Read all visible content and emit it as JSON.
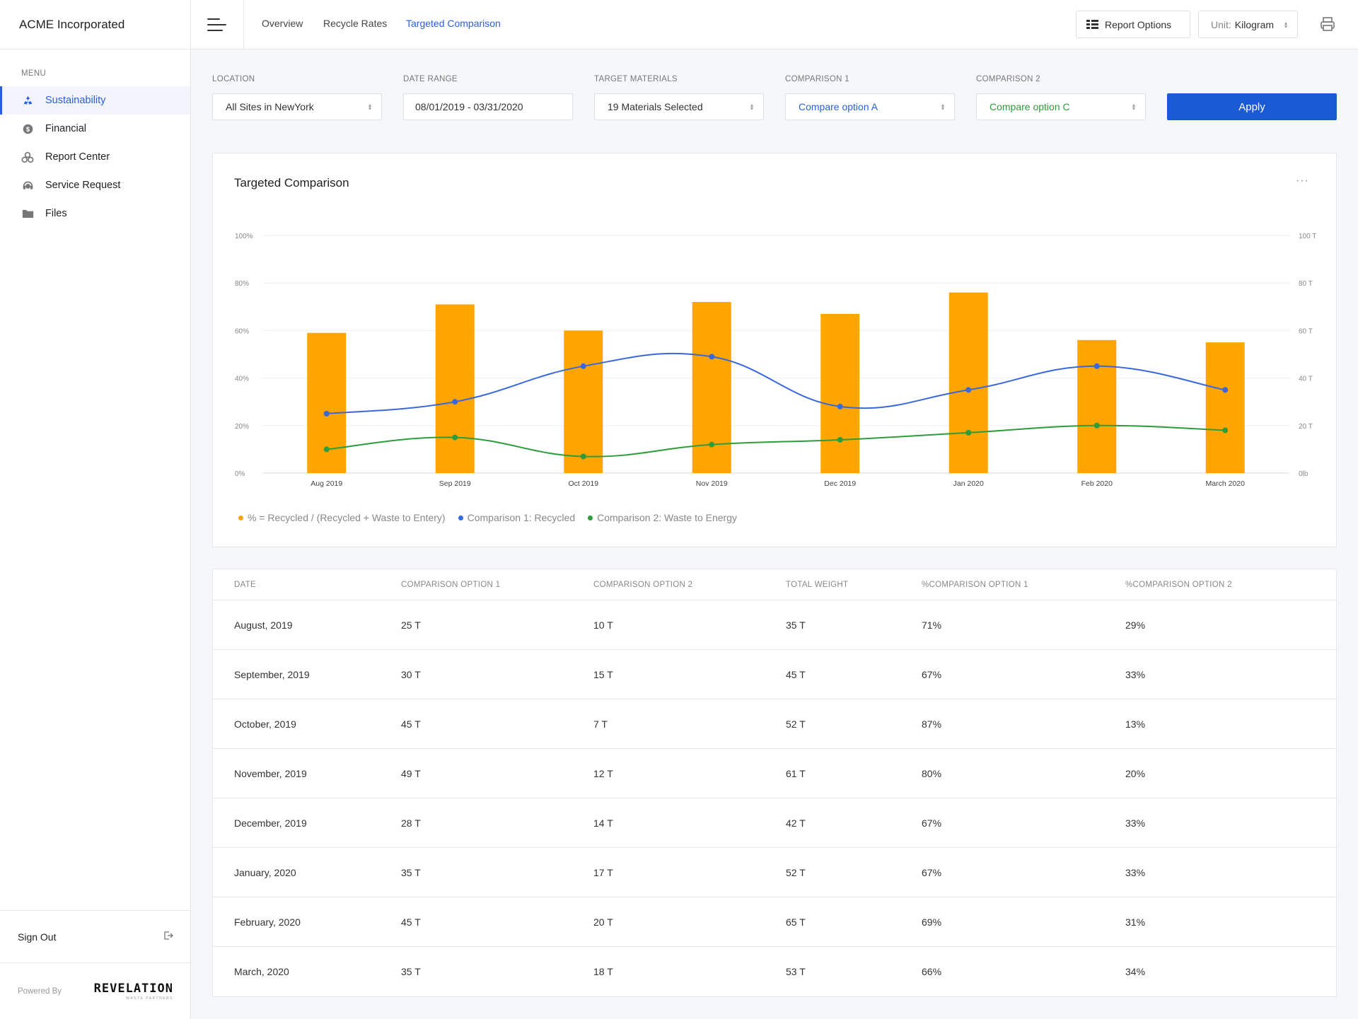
{
  "app": {
    "title": "ACME Incorporated"
  },
  "sidebar": {
    "menu_title": "MENU",
    "items": [
      {
        "label": "Sustainability",
        "icon": "recycle-icon",
        "active": true
      },
      {
        "label": "Financial",
        "icon": "dollar-icon",
        "active": false
      },
      {
        "label": "Report Center",
        "icon": "report-center-icon",
        "active": false
      },
      {
        "label": "Service Request",
        "icon": "service-request-icon",
        "active": false
      },
      {
        "label": "Files",
        "icon": "folder-icon",
        "active": false
      }
    ],
    "sign_out": "Sign Out",
    "powered_by": "Powered By",
    "logo_text": "REVELATION",
    "logo_sub": "WASTE PARTNERS"
  },
  "topbar": {
    "tabs": [
      {
        "label": "Overview",
        "active": false
      },
      {
        "label": "Recycle Rates",
        "active": false
      },
      {
        "label": "Targeted Comparison",
        "active": true
      }
    ],
    "report_options": "Report Options",
    "unit_label": "Unit:",
    "unit_value": "Kilogram"
  },
  "filters": {
    "location": {
      "label": "LOCATION",
      "value": "All Sites in NewYork"
    },
    "date_range": {
      "label": "DATE RANGE",
      "value": "08/01/2019 - 03/31/2020"
    },
    "materials": {
      "label": "TARGET MATERIALS",
      "value": "19 Materials Selected"
    },
    "comparison1": {
      "label": "COMPARISON 1",
      "value": "Compare option A",
      "color": "#2b5fd9"
    },
    "comparison2": {
      "label": "COMPARISON 2",
      "value": "Compare option C",
      "color": "#2e9c3a"
    },
    "apply": "Apply"
  },
  "chart_card": {
    "title": "Targeted Comparison",
    "menu": "···"
  },
  "chart_data": {
    "type": "bar+line",
    "title": "Targeted Comparison",
    "categories": [
      "Aug 2019",
      "Sep 2019",
      "Oct 2019",
      "Nov 2019",
      "Dec 2019",
      "Jan 2020",
      "Feb 2020",
      "March 2020"
    ],
    "left_axis": {
      "ticks": [
        "0%",
        "20%",
        "40%",
        "60%",
        "80%",
        "100%"
      ],
      "ylim": [
        0,
        100
      ]
    },
    "right_axis": {
      "ticks": [
        "0lb",
        "20 T",
        "40 T",
        "60 T",
        "80 T",
        "100 T"
      ],
      "ylim": [
        0,
        100
      ]
    },
    "grid": true,
    "series": [
      {
        "name": "% = Recycled / (Recycled + Waste to Entery)",
        "type": "bar",
        "color": "#ffa500",
        "values": [
          59,
          71,
          60,
          72,
          67,
          76,
          56,
          55
        ]
      },
      {
        "name": "Comparison 1: Recycled",
        "type": "line",
        "color": "#3a68db",
        "values": [
          25,
          30,
          45,
          49,
          28,
          35,
          45,
          35
        ]
      },
      {
        "name": "Comparison 2: Waste to Energy",
        "type": "line",
        "color": "#2e9c3a",
        "values": [
          10,
          15,
          7,
          12,
          14,
          17,
          20,
          18
        ]
      }
    ],
    "legend_position": "bottom-left"
  },
  "table": {
    "headers": [
      "DATE",
      "COMPARISON OPTION 1",
      "COMPARISON OPTION 2",
      "TOTAL WEIGHT",
      "%COMPARISON OPTION 1",
      "%COMPARISON OPTION 2"
    ],
    "rows": [
      [
        "August, 2019",
        "25 T",
        "10 T",
        "35 T",
        "71%",
        "29%"
      ],
      [
        "September, 2019",
        "30 T",
        "15 T",
        "45 T",
        "67%",
        "33%"
      ],
      [
        "October, 2019",
        "45 T",
        "7 T",
        "52 T",
        "87%",
        "13%"
      ],
      [
        "November, 2019",
        "49 T",
        "12 T",
        "61 T",
        "80%",
        "20%"
      ],
      [
        "December, 2019",
        "28 T",
        "14 T",
        "42 T",
        "67%",
        "33%"
      ],
      [
        "January, 2020",
        "35 T",
        "17 T",
        "52 T",
        "67%",
        "33%"
      ],
      [
        "February, 2020",
        "45 T",
        "20 T",
        "65 T",
        "69%",
        "31%"
      ],
      [
        "March, 2020",
        "35 T",
        "18 T",
        "53 T",
        "66%",
        "34%"
      ]
    ]
  }
}
